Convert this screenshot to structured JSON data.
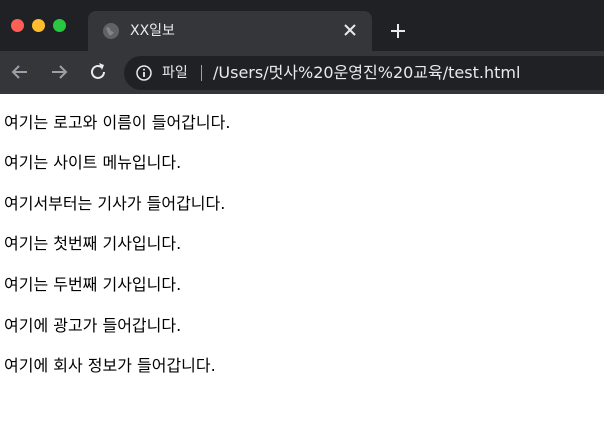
{
  "tab": {
    "title": "XX일보"
  },
  "omnibox": {
    "scheme_label": "파일",
    "url": "/Users/멋사%20운영진%20교육/test.html"
  },
  "icons": {
    "favicon": "globe-icon",
    "tab_close": "close-icon",
    "new_tab": "plus-icon",
    "back": "arrow-left-icon",
    "forward": "arrow-right-icon",
    "reload": "reload-icon",
    "info": "info-icon"
  },
  "colors": {
    "titlebar": "#202124",
    "tab_active": "#35363a",
    "omnibox_bg": "#202124",
    "traffic_red": "#ff5f57",
    "traffic_yellow": "#febc2e",
    "traffic_green": "#28c840",
    "page_background": "#ffffff",
    "page_text": "#000000"
  },
  "page": {
    "lines": [
      "여기는 로고와 이름이 들어갑니다.",
      "여기는 사이트 메뉴입니다.",
      "여기서부터는 기사가 들어갑니다.",
      "여기는 첫번째 기사입니다.",
      "여기는 두번째 기사입니다.",
      "여기에 광고가 들어갑니다.",
      "여기에 회사 정보가 들어갑니다."
    ]
  }
}
